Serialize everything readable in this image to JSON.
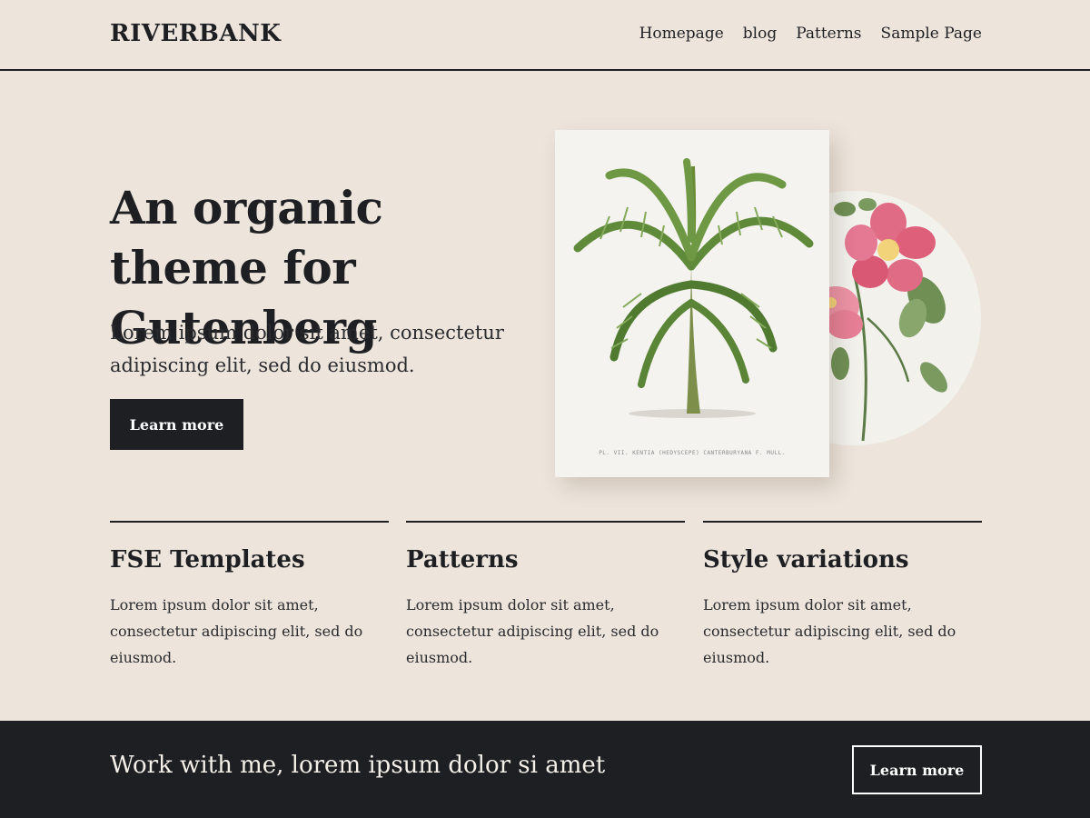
{
  "header": {
    "logo": "RIVERBANK",
    "nav": [
      "Homepage",
      "blog",
      "Patterns",
      "Sample Page"
    ]
  },
  "hero": {
    "title": "An organic theme for Gutenberg",
    "subtitle": "Lorem ipsum dolor sit amet, consectetur adipiscing elit, sed do eiusmod.",
    "button_label": "Learn more",
    "plate_caption": "PL. VII. KENTIA (HEDYSCEPE) CANTERBURYANA F. MULL."
  },
  "features": [
    {
      "title": "FSE Templates",
      "text": "Lorem ipsum dolor sit amet, consectetur adipiscing elit, sed do eiusmod."
    },
    {
      "title": "Patterns",
      "text": "Lorem ipsum dolor sit amet, consectetur adipiscing elit, sed do eiusmod."
    },
    {
      "title": "Style variations",
      "text": "Lorem ipsum dolor sit amet, consectetur adipiscing elit, sed do eiusmod."
    }
  ],
  "footer": {
    "text": "Work with me, lorem ipsum dolor si amet",
    "button_label": "Learn more"
  },
  "colors": {
    "background": "#ede5dc",
    "dark": "#1e1f23",
    "leaf_green": "#5f8a3a",
    "flower_pink": "#e06b84"
  }
}
